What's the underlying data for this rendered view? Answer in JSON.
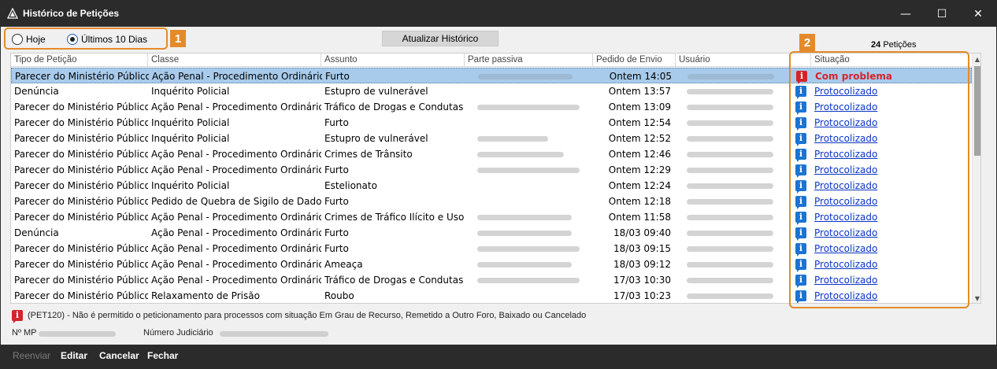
{
  "window": {
    "title": "Histórico de Petições",
    "minimize": "—",
    "maximize": "☐",
    "close": "✕"
  },
  "filters": {
    "options": [
      {
        "label": "Hoje",
        "selected": false
      },
      {
        "label": "Últimos 10 Dias",
        "selected": true
      }
    ],
    "badge": "1"
  },
  "toolbar": {
    "refresh_label": "Atualizar Histórico"
  },
  "counter": {
    "count": "24",
    "label": "Petições"
  },
  "situation_badge": "2",
  "table": {
    "columns": [
      "Tipo de Petição",
      "Classe",
      "Assunto",
      "Parte passiva",
      "Pedido de Envio",
      "Usuário",
      "",
      "Situação"
    ],
    "rows": [
      {
        "tipo": "Parecer do Ministério Público",
        "classe": "Ação Penal - Procedimento Ordinário",
        "assunto": "Furto",
        "pedido": "Ontem 14:05",
        "situacao": "Com problema",
        "status_type": "problem"
      },
      {
        "tipo": "Denúncia",
        "classe": "Inquérito Policial",
        "assunto": "Estupro de vulnerável",
        "pedido": "Ontem 13:57",
        "situacao": "Protocolizado",
        "status_type": "ok"
      },
      {
        "tipo": "Parecer do Ministério Público",
        "classe": "Ação Penal - Procedimento Ordinário",
        "assunto": "Tráfico de Drogas e Condutas",
        "pedido": "Ontem 13:09",
        "situacao": "Protocolizado",
        "status_type": "ok"
      },
      {
        "tipo": "Parecer do Ministério Público",
        "classe": "Inquérito Policial",
        "assunto": "Furto",
        "pedido": "Ontem 12:54",
        "situacao": "Protocolizado",
        "status_type": "ok"
      },
      {
        "tipo": "Parecer do Ministério Público",
        "classe": "Inquérito Policial",
        "assunto": "Estupro de vulnerável",
        "pedido": "Ontem 12:52",
        "situacao": "Protocolizado",
        "status_type": "ok"
      },
      {
        "tipo": "Parecer do Ministério Público",
        "classe": "Ação Penal - Procedimento Ordinário",
        "assunto": "Crimes de Trânsito",
        "pedido": "Ontem 12:46",
        "situacao": "Protocolizado",
        "status_type": "ok"
      },
      {
        "tipo": "Parecer do Ministério Público",
        "classe": "Ação Penal - Procedimento Ordinário",
        "assunto": "Furto",
        "pedido": "Ontem 12:29",
        "situacao": "Protocolizado",
        "status_type": "ok"
      },
      {
        "tipo": "Parecer do Ministério Público",
        "classe": "Inquérito Policial",
        "assunto": "Estelionato",
        "pedido": "Ontem 12:24",
        "situacao": "Protocolizado",
        "status_type": "ok"
      },
      {
        "tipo": "Parecer do Ministério Público",
        "classe": "Pedido de Quebra de Sigilo de Dado",
        "assunto": "Furto",
        "pedido": "Ontem 12:18",
        "situacao": "Protocolizado",
        "status_type": "ok"
      },
      {
        "tipo": "Parecer do Ministério Público",
        "classe": "Ação Penal - Procedimento Ordinário",
        "assunto": "Crimes de Tráfico Ilícito e Uso",
        "pedido": "Ontem 11:58",
        "situacao": "Protocolizado",
        "status_type": "ok"
      },
      {
        "tipo": "Denúncia",
        "classe": "Ação Penal - Procedimento Ordinário",
        "assunto": "Furto",
        "pedido": "18/03 09:40",
        "situacao": "Protocolizado",
        "status_type": "ok"
      },
      {
        "tipo": "Parecer do Ministério Público",
        "classe": "Ação Penal - Procedimento Ordinário",
        "assunto": "Furto",
        "pedido": "18/03 09:15",
        "situacao": "Protocolizado",
        "status_type": "ok"
      },
      {
        "tipo": "Parecer do Ministério Público",
        "classe": "Ação Penal - Procedimento Ordinário",
        "assunto": "Ameaça",
        "pedido": "18/03 09:12",
        "situacao": "Protocolizado",
        "status_type": "ok"
      },
      {
        "tipo": "Parecer do Ministério Público",
        "classe": "Ação Penal - Procedimento Ordinário",
        "assunto": "Tráfico de Drogas e Condutas",
        "pedido": "17/03 10:30",
        "situacao": "Protocolizado",
        "status_type": "ok"
      },
      {
        "tipo": "Parecer do Ministério Público",
        "classe": "Relaxamento de Prisão",
        "assunto": "Roubo",
        "pedido": "17/03 10:23",
        "situacao": "Protocolizado",
        "status_type": "ok"
      }
    ]
  },
  "footer": {
    "warning": "(PET120) - Não é permitido o peticionamento para processos com situação Em Grau de Recurso,  Remetido a Outro Foro, Baixado ou Cancelado",
    "mp_label": "Nº MP",
    "judicial_label": "Número Judiciário"
  },
  "actions": {
    "resend": "Reenviar",
    "edit": "Editar",
    "cancel": "Cancelar",
    "close": "Fechar"
  },
  "colors": {
    "accent": "#e38b2a",
    "selected_row": "#a8cbeb",
    "link": "#0b35c4",
    "problem": "#d6232b",
    "info_icon": "#1c73d1"
  }
}
